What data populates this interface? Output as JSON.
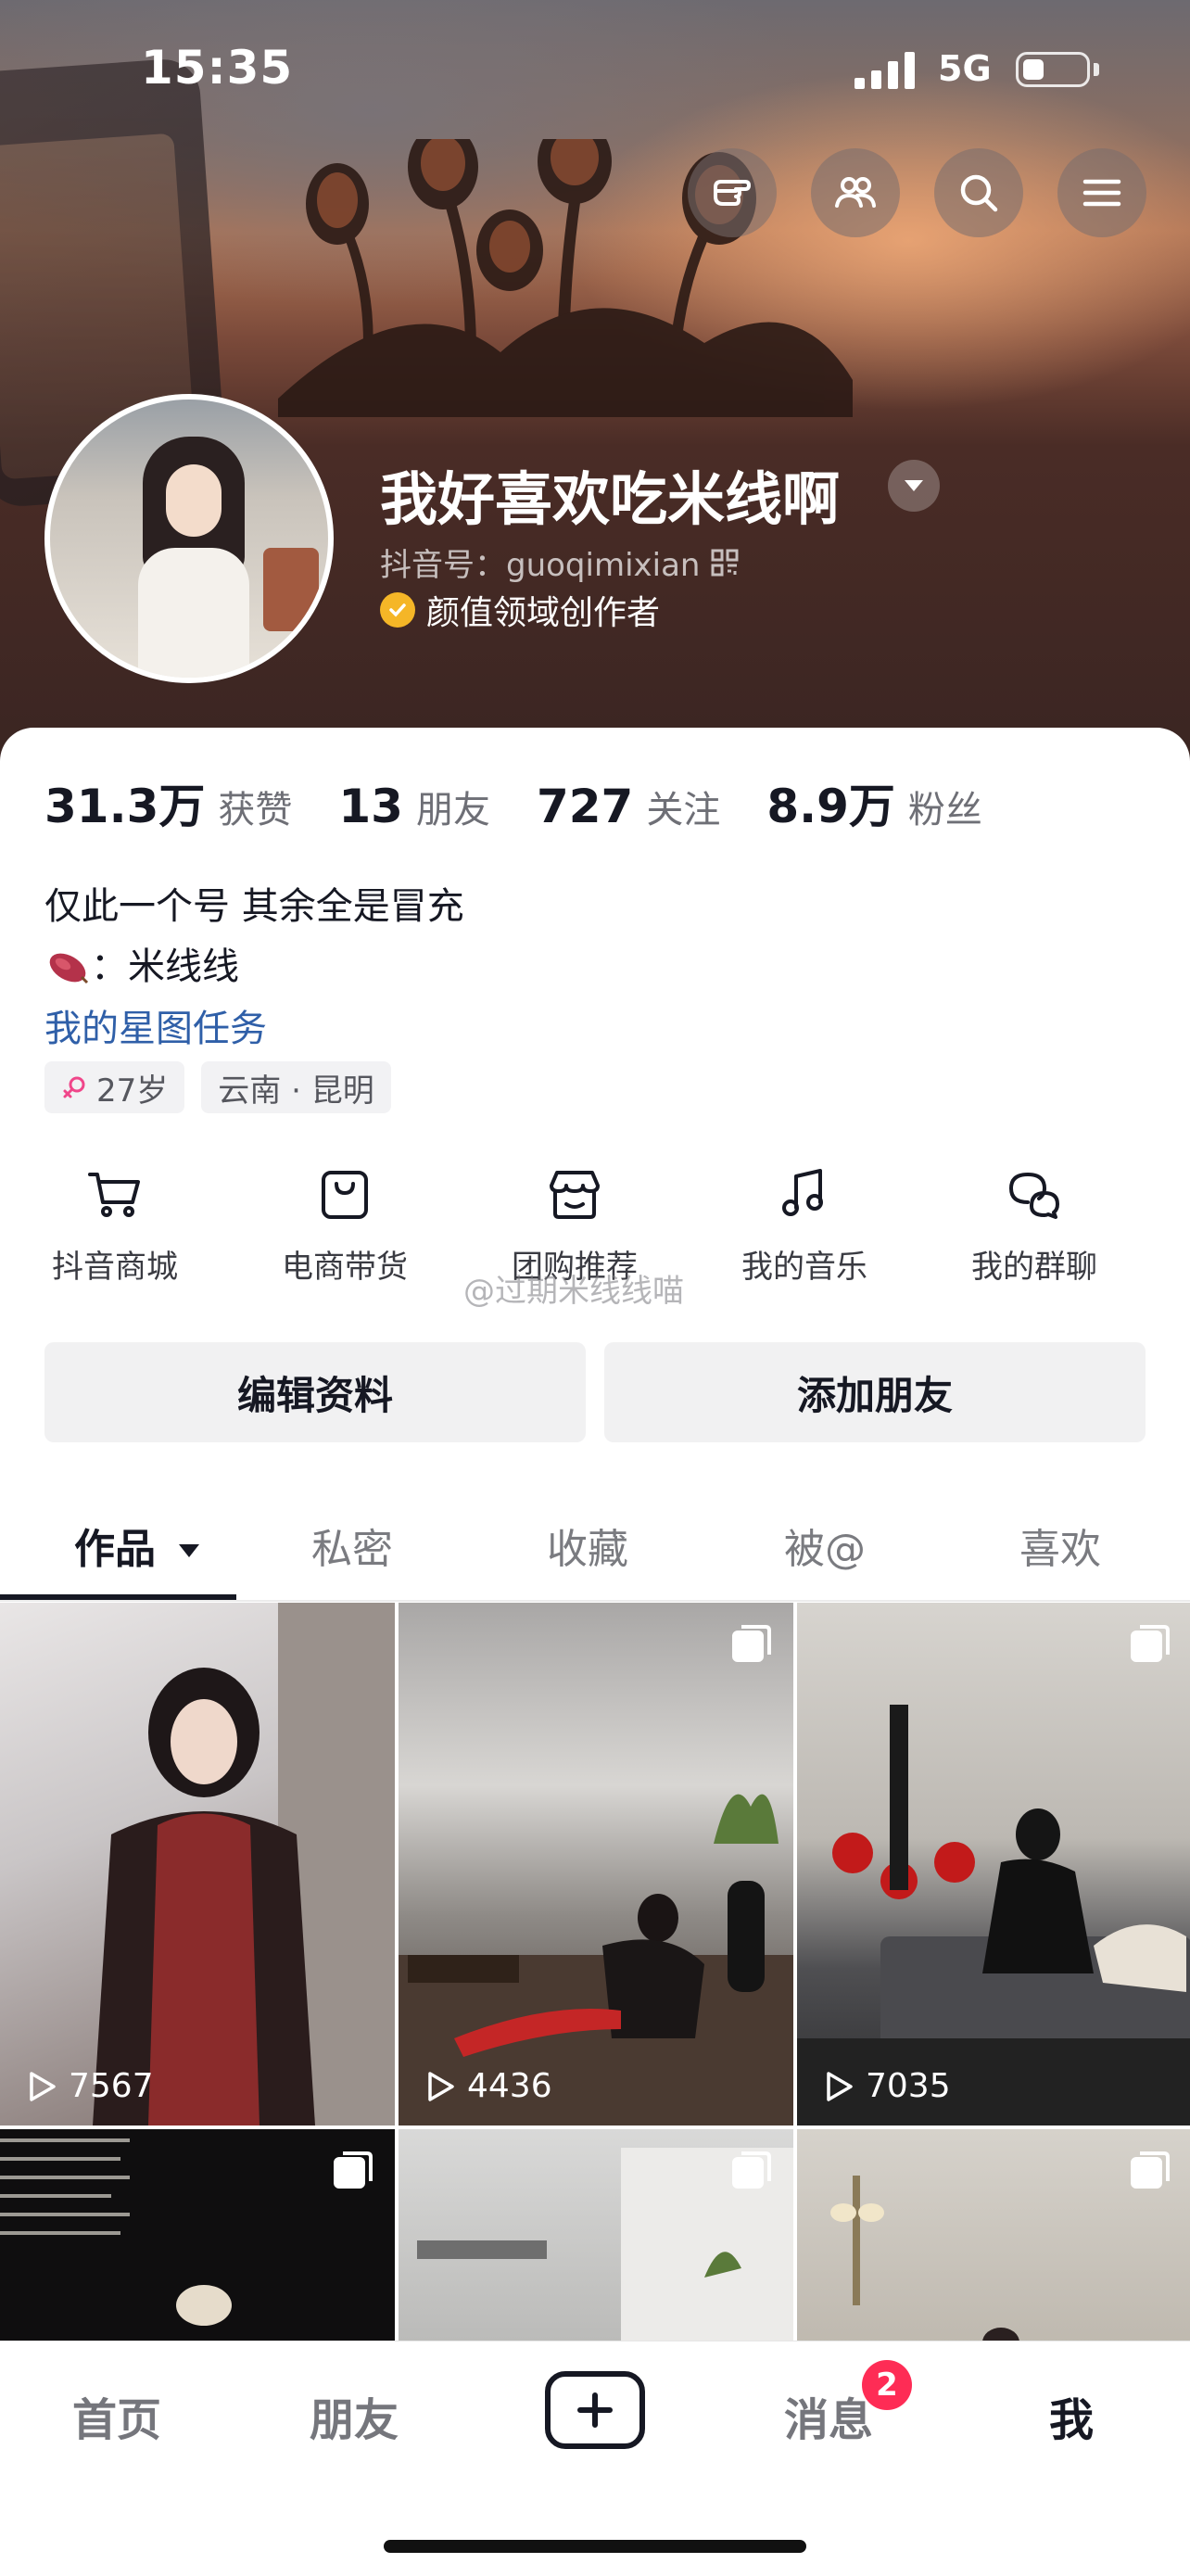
{
  "status_bar": {
    "time": "15:35",
    "network": "5G"
  },
  "header": {
    "buttons": [
      "point-hand-icon",
      "friends-icon",
      "search-icon",
      "menu-icon"
    ]
  },
  "profile": {
    "username": "我好喜欢吃米线啊",
    "douyin_id": "抖音号：guoqimixian",
    "creator_badge": "颜值领域创作者"
  },
  "stats": [
    {
      "value": "31.3万",
      "label": "获赞"
    },
    {
      "value": "13",
      "label": "朋友"
    },
    {
      "value": "727",
      "label": "关注"
    },
    {
      "value": "8.9万",
      "label": "粉丝"
    }
  ],
  "bio": {
    "line1": "仅此一个号 其余全是冒充",
    "line2": "：米线线",
    "link": "我的星图任务"
  },
  "tags": [
    {
      "text": "27岁",
      "icon": "female-icon"
    },
    {
      "text": "云南 · 昆明"
    }
  ],
  "services": [
    {
      "label": "抖音商城",
      "icon": "cart-icon"
    },
    {
      "label": "电商带货",
      "icon": "bag-icon"
    },
    {
      "label": "团购推荐",
      "icon": "store-icon"
    },
    {
      "label": "我的音乐",
      "icon": "music-icon"
    },
    {
      "label": "我的群聊",
      "icon": "chat-icon"
    }
  ],
  "watermark": "@过期米线线喵",
  "actions": {
    "edit": "编辑资料",
    "add_friend": "添加朋友"
  },
  "tabs": [
    "作品",
    "私密",
    "收藏",
    "被@",
    "喜欢"
  ],
  "videos": [
    {
      "plays": "7567"
    },
    {
      "plays": "4436"
    },
    {
      "plays": "7035"
    }
  ],
  "bottom_nav": {
    "home": "首页",
    "friends": "朋友",
    "messages": "消息",
    "messages_badge": "2",
    "me": "我"
  },
  "colors": {
    "accent": "#fe2c55",
    "link": "#2f5fa8",
    "badge_gold": "#f5b627"
  }
}
